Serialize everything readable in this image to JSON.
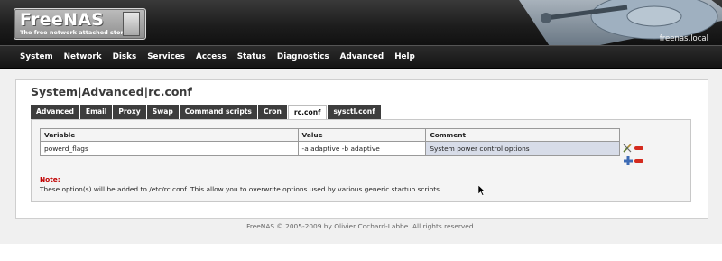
{
  "header": {
    "logo_title": "FreeNAS",
    "logo_tagline": "The free network attached storage",
    "hostname": "freenas.local"
  },
  "menu": {
    "items": [
      "System",
      "Network",
      "Disks",
      "Services",
      "Access",
      "Status",
      "Diagnostics",
      "Advanced",
      "Help"
    ]
  },
  "page": {
    "title": "System|Advanced|rc.conf"
  },
  "tabs": [
    {
      "label": "Advanced",
      "active": false
    },
    {
      "label": "Email",
      "active": false
    },
    {
      "label": "Proxy",
      "active": false
    },
    {
      "label": "Swap",
      "active": false
    },
    {
      "label": "Command scripts",
      "active": false
    },
    {
      "label": "Cron",
      "active": false
    },
    {
      "label": "rc.conf",
      "active": true
    },
    {
      "label": "sysctl.conf",
      "active": false
    }
  ],
  "table": {
    "headers": [
      "Variable",
      "Value",
      "Comment"
    ],
    "rows": [
      {
        "variable": "powerd_flags",
        "value": "-a adaptive -b adaptive",
        "comment": "System power control options"
      }
    ]
  },
  "icons": {
    "edit": "edit-icon",
    "delete": "delete-icon",
    "add": "add-icon"
  },
  "note": {
    "label": "Note:",
    "text": "These option(s) will be added to /etc/rc.conf. This allow you to overwrite options used by various generic startup scripts."
  },
  "footer": {
    "copyright": "FreeNAS © 2005-2009 by Olivier Cochard-Labbe. All rights reserved."
  },
  "colors": {
    "accent_red": "#c00000",
    "menu_bg": "#1c1c1c",
    "selected_cell": "#d7dce8"
  }
}
